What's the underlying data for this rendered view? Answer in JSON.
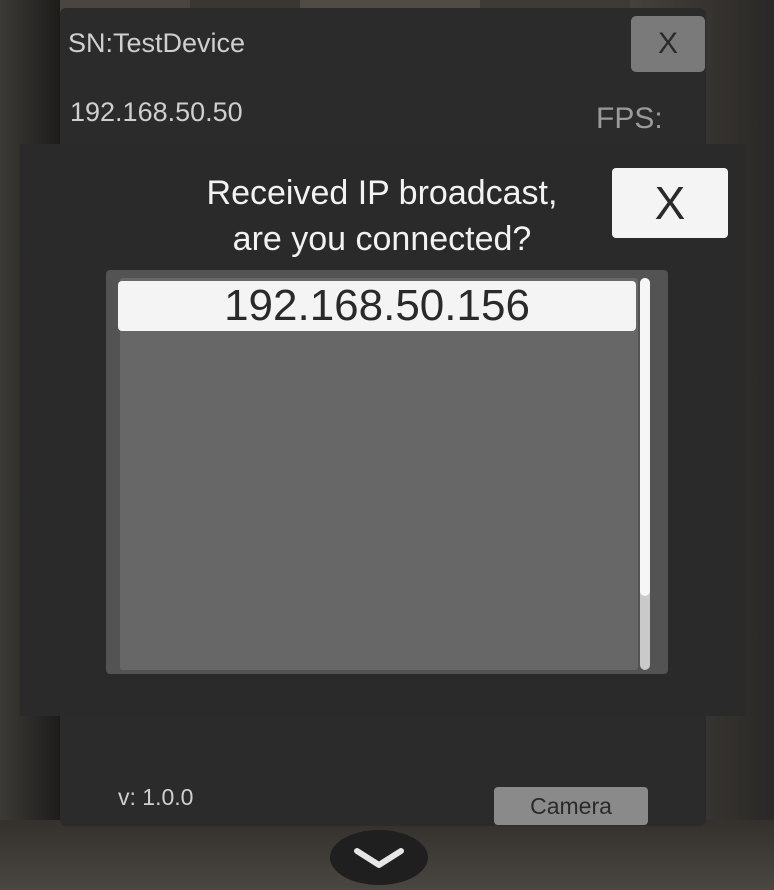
{
  "header": {
    "serial": "SN:TestDevice",
    "ip": "192.168.50.50",
    "fps_label": "FPS:",
    "close_label": "X"
  },
  "dialog": {
    "title_line1": "Received IP broadcast,",
    "title_line2": "are you connected?",
    "close_label": "X",
    "items": [
      "192.168.50.156"
    ]
  },
  "footer": {
    "version": "v: 1.0.0",
    "camera_label": "Camera"
  },
  "icons": {
    "expand": "chevron-down-icon"
  }
}
